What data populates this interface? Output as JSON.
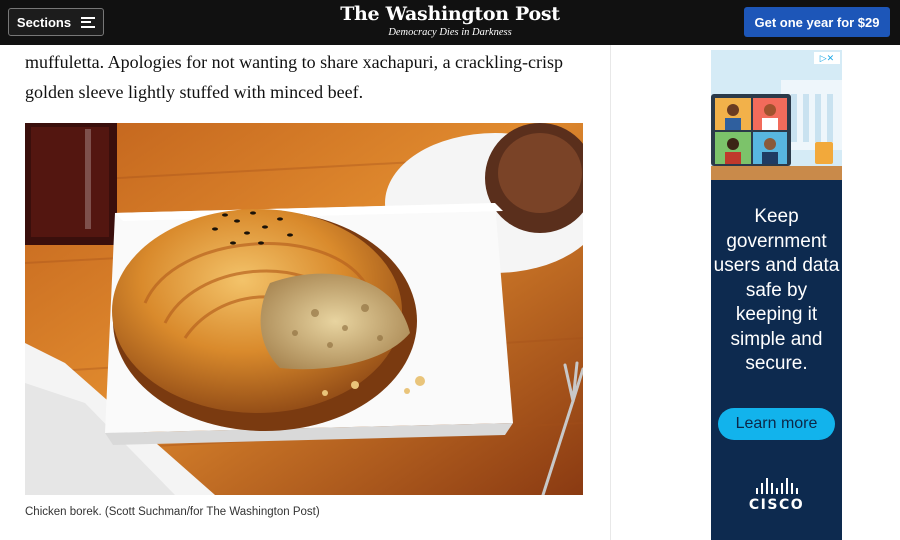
{
  "header": {
    "sections_label": "Sections",
    "logo": "The Washington Post",
    "tagline": "Democracy Dies in Darkness",
    "subscribe_label": "Get one year for $29"
  },
  "article": {
    "paragraph": "muffuletta. Apologies for not wanting to share xachapuri, a crackling-crisp golden sleeve lightly stuffed with minced beef.",
    "photo_alt": "Chicken borek",
    "caption": "Chicken borek. (Scott Suchman/for The Washington Post)"
  },
  "ad": {
    "headline": "Keep government users and data safe by keeping it simple and secure.",
    "cta_label": "Learn more",
    "brand": "CISCO",
    "adchoices_icon": "adchoices-icon"
  },
  "colors": {
    "header_bg": "#111111",
    "subscribe_bg": "#1d56b8",
    "ad_bg": "#0d2a4f",
    "ad_cta": "#12b3ec"
  }
}
